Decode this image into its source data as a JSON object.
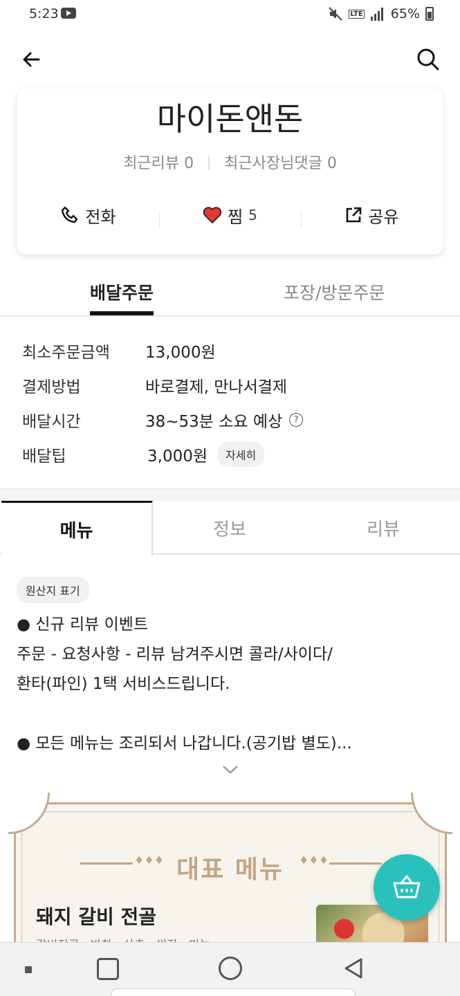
{
  "status_bar": {
    "time": "5:23",
    "signal_label": "LTE",
    "battery": "65%"
  },
  "store": {
    "name": "마이돈앤돈",
    "recent_reviews": "최근리뷰 0",
    "recent_owner_replies": "최근사장님댓글 0",
    "call_label": "전화",
    "like_label": "찜",
    "like_count": "5",
    "share_label": "공유"
  },
  "order_tabs": {
    "delivery": "배달주문",
    "pickup": "포장/방문주문"
  },
  "info": {
    "min_order_label": "최소주문금액",
    "min_order_value": "13,000원",
    "payment_label": "결제방법",
    "payment_value": "바로결제, 만나서결제",
    "delivery_time_label": "배달시간",
    "delivery_time_value": "38~53분 소요 예상",
    "tip_label": "배달팁",
    "tip_value": "3,000원",
    "tip_detail_button": "자세히"
  },
  "main_tabs": {
    "menu": "메뉴",
    "info": "정보",
    "review": "리뷰"
  },
  "notice": {
    "origin_badge": "원산지 표기",
    "line1": "● 신규 리뷰 이벤트",
    "line2": "주문 - 요청사항 - 리뷰 남겨주시면 콜라/사이다/",
    "line3": "환타(파인) 1택 서비스드립니다.",
    "line4": "● 모든 메뉴는 조리되서 나갑니다.(공기밥 별도)..."
  },
  "banner": {
    "title": "대표 메뉴",
    "deco": "♦♦♦",
    "dish_name": "돼지 갈비 전골",
    "dish_desc": "갈비전골 · 반찬 · 상추 · 쌈장 · 마늘"
  },
  "colors": {
    "accent": "#2ac1bc",
    "banner_gold": "#c4a583",
    "heart": "#e53935"
  }
}
